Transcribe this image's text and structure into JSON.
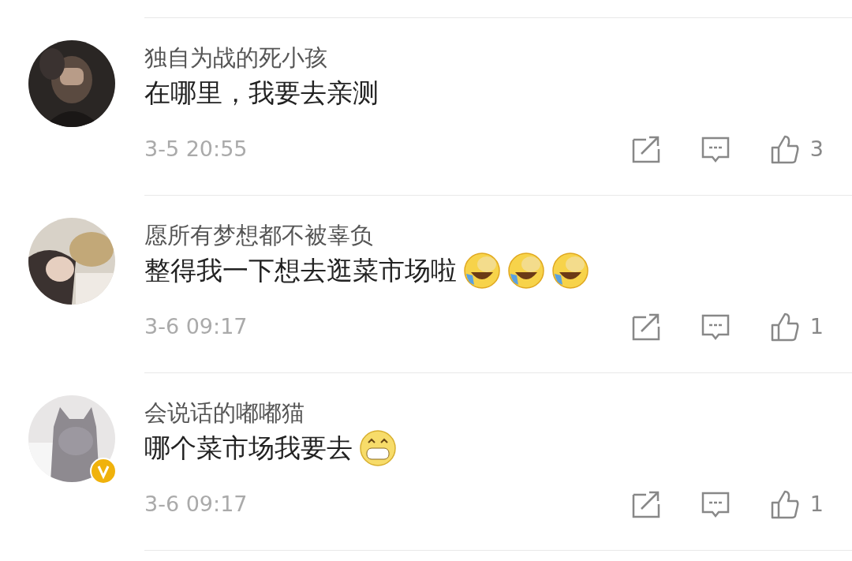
{
  "comments": [
    {
      "username": "独自为战的死小孩",
      "text": "在哪里，我要去亲测",
      "verified": false,
      "time": "3-5 20:55",
      "likes": "3"
    },
    {
      "username": "愿所有梦想都不被辜负",
      "text": "整得我一下想去逛菜市场啦",
      "emojis": [
        {
          "kind": "laugh-cry"
        },
        {
          "kind": "laugh-cry"
        },
        {
          "kind": "laugh-cry"
        }
      ],
      "verified": false,
      "time": "3-6 09:17",
      "likes": "1"
    },
    {
      "username": "会说话的嘟嘟猫",
      "text": "哪个菜市场我要去",
      "emojis": [
        {
          "kind": "grin"
        }
      ],
      "verified": true,
      "time": "3-6 09:17",
      "likes": "1"
    }
  ]
}
